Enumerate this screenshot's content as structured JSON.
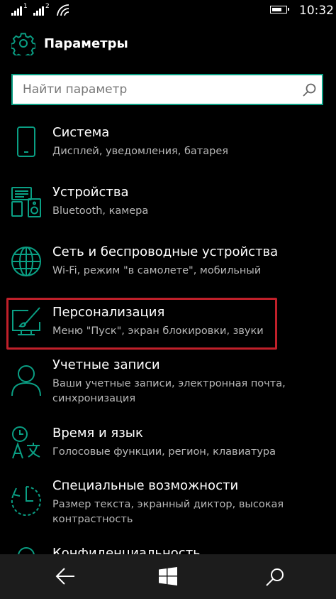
{
  "status_bar": {
    "sim1": "1",
    "sim2": "2",
    "time": "10:32",
    "battery_level": 0.75
  },
  "header": {
    "title": "Параметры",
    "icon": "gear-icon"
  },
  "search": {
    "placeholder": "Найти параметр",
    "value": "",
    "icon": "search-icon"
  },
  "settings": [
    {
      "name": "Система",
      "description": "Дисплей, уведомления, батарея",
      "icon": "phone-icon"
    },
    {
      "name": "Устройства",
      "description": "Bluetooth, камера",
      "icon": "devices-icon"
    },
    {
      "name": "Сеть и беспроводные устройства",
      "description": "Wi-Fi, режим \"в самолете\", мобильный",
      "icon": "globe-icon"
    },
    {
      "name": "Персонализация",
      "description": "Меню \"Пуск\", экран блокировки, звуки",
      "icon": "personalization-icon"
    },
    {
      "name": "Учетные записи",
      "description": "Ваши учетные записи, электронная почта, синхронизация",
      "icon": "person-icon"
    },
    {
      "name": "Время и язык",
      "description": "Голосовые функции, регион, клавиатура",
      "icon": "time-language-icon"
    },
    {
      "name": "Специальные возможности",
      "description": "Размер текста, экранный диктор, высокая контрастность",
      "icon": "ease-of-access-icon"
    },
    {
      "name": "Конфиденциальность",
      "description": "",
      "icon": "lock-icon"
    }
  ],
  "navbar": {
    "back": "back-arrow-icon",
    "start": "windows-logo-icon",
    "search": "search-icon"
  },
  "colors": {
    "accent": "#0a9f84",
    "highlight": "#c0202a",
    "background": "#000000",
    "navbar": "#1c1c1c"
  }
}
